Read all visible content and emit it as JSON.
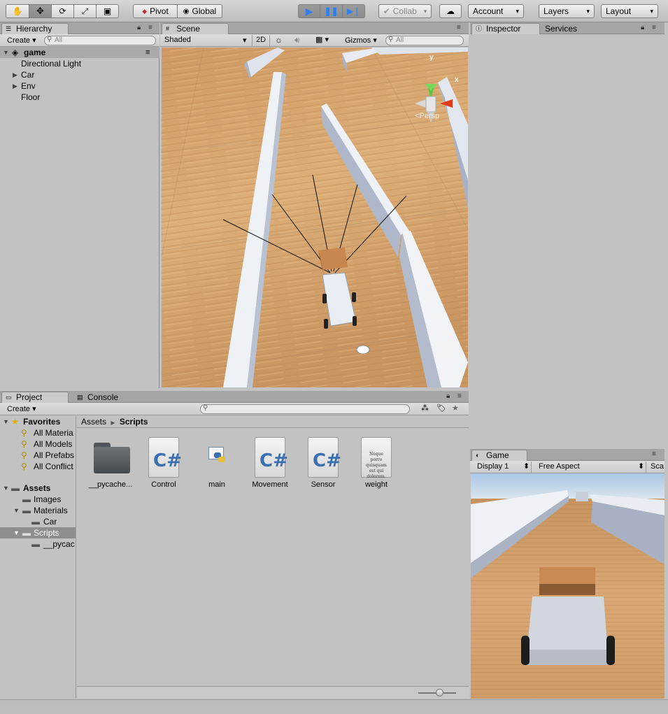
{
  "toolbar": {
    "tools": [
      "hand-tool",
      "move-tool",
      "rotate-tool",
      "scale-tool",
      "rect-tool"
    ],
    "pivot": "Pivot",
    "global": "Global",
    "collab": "Collab",
    "account": "Account",
    "layers": "Layers",
    "layout": "Layout"
  },
  "hierarchy": {
    "tab": "Hierarchy",
    "create": "Create",
    "search_placeholder": "All",
    "scene": "game",
    "items": [
      "Directional Light",
      "Car",
      "Env",
      "Floor"
    ]
  },
  "scene": {
    "tab": "Scene",
    "shading": "Shaded",
    "mode_2d": "2D",
    "gizmos": "Gizmos",
    "search_placeholder": "All",
    "persp": "Persp",
    "axis_y": "y",
    "axis_x": "x"
  },
  "inspector": {
    "tab": "Inspector",
    "services": "Services"
  },
  "project": {
    "tab": "Project",
    "console": "Console",
    "create": "Create",
    "favorites": "Favorites",
    "fav_items": [
      "All Materia",
      "All Models",
      "All Prefabs",
      "All Conflict"
    ],
    "assets": "Assets",
    "asset_folders": [
      "Images",
      "Materials",
      "Car",
      "Scripts",
      "__pycac"
    ],
    "breadcrumb_root": "Assets",
    "breadcrumb_current": "Scripts",
    "files": [
      "__pycache...",
      "Control",
      "main",
      "Movement",
      "Sensor",
      "weight"
    ],
    "weight_preview": "Neque porro quisquam est qui dolorem."
  },
  "game": {
    "tab": "Game",
    "display": "Display 1",
    "aspect": "Free Aspect",
    "scale": "Sca"
  },
  "colors": {
    "accent": "#3e7de0",
    "panel": "#c2c2c2",
    "selected": "#8e8e8e"
  }
}
